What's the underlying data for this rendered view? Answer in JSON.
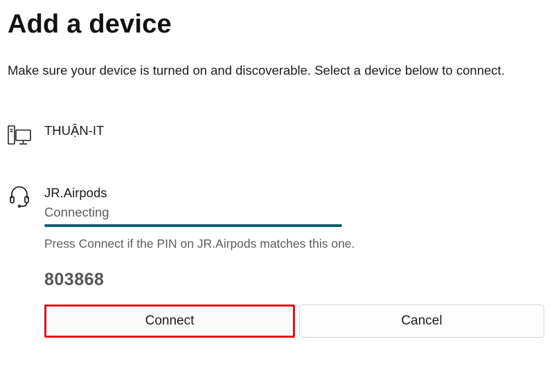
{
  "dialog": {
    "title": "Add a device",
    "subtitle": "Make sure your device is turned on and discoverable. Select a device below to connect."
  },
  "devices": [
    {
      "name": "THUẬN-IT",
      "icon": "computer-icon"
    },
    {
      "name": "JR.Airpods",
      "icon": "headset-icon",
      "status": "Connecting",
      "progress": 1.0,
      "pin_message": "Press Connect if the PIN on JR.Airpods matches this one.",
      "pin": "803868"
    }
  ],
  "buttons": {
    "connect_label": "Connect",
    "cancel_label": "Cancel"
  },
  "colors": {
    "progress": "#0d5f6b",
    "highlight": "#e0111d"
  }
}
